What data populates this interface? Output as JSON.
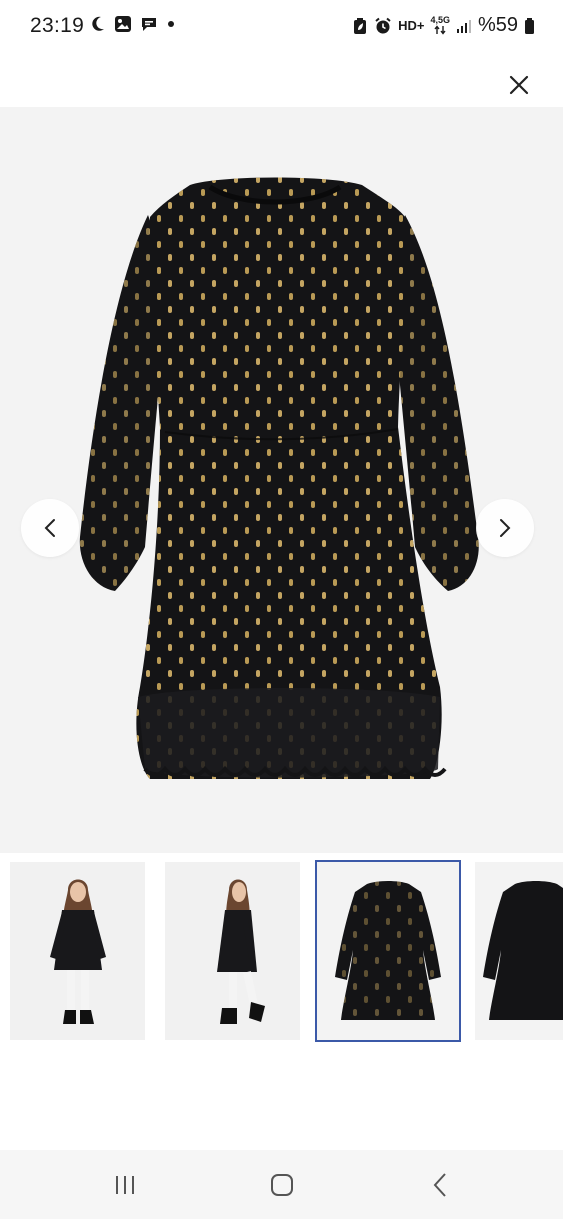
{
  "status_bar": {
    "time": "23:19",
    "left_icons": [
      "moon-icon",
      "gallery-icon",
      "chat-icon",
      "dot-icon"
    ],
    "hd_label": "HD+",
    "network_label": "4,5G",
    "battery_text": "%59"
  },
  "header": {
    "close_icon": "close-icon"
  },
  "product": {
    "main_image": "black-dress-gold-dots",
    "current_index": 3,
    "thumbnails": [
      {
        "image": "girl-front-dress"
      },
      {
        "image": "girl-side-dress"
      },
      {
        "image": "dress-flat",
        "selected": true
      },
      {
        "image": "dress-flat-partial"
      }
    ]
  },
  "colors": {
    "dress": "#141416",
    "dot": "#b99a55",
    "background": "#f3f3f3",
    "selected_border": "#3b59a8"
  },
  "navigation_bar": {
    "buttons": [
      "recents-icon",
      "home-icon",
      "back-icon"
    ]
  }
}
